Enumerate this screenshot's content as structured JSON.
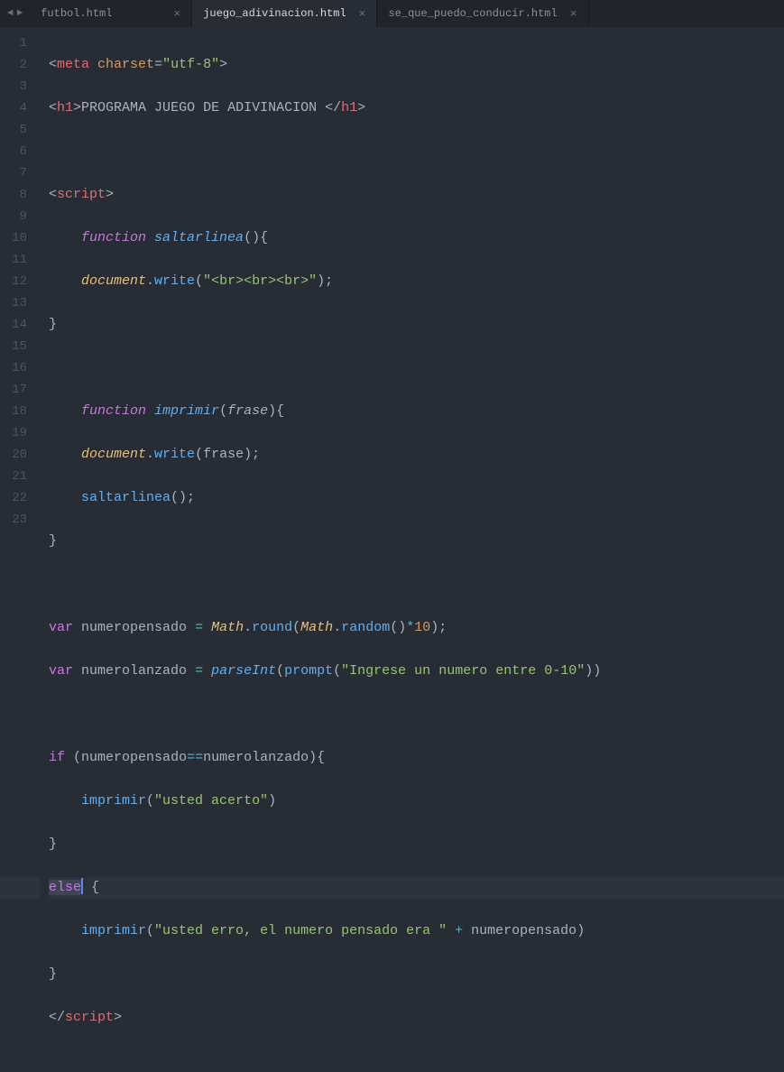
{
  "tabs": [
    {
      "label": "futbol.html",
      "active": false
    },
    {
      "label": "juego_adivinacion.html",
      "active": true
    },
    {
      "label": "se_que_puedo_conducir.html",
      "active": false
    }
  ],
  "lineNumbers": [
    "1",
    "2",
    "3",
    "4",
    "5",
    "6",
    "7",
    "8",
    "9",
    "10",
    "11",
    "12",
    "13",
    "14",
    "15",
    "16",
    "17",
    "18",
    "19",
    "20",
    "21",
    "22",
    "23"
  ],
  "tokens": {
    "meta": "meta",
    "charset": "charset",
    "utf8": "\"utf-8\"",
    "h1open": "h1",
    "h1text": "PROGRAMA JUEGO DE ADIVINACION ",
    "h1close": "h1",
    "script": "script",
    "function": "function",
    "saltarlinea": "saltarlinea",
    "document": "document",
    "write": "write",
    "brstr": "\"<br><br><br>\"",
    "imprimir": "imprimir",
    "frase": "frase",
    "var": "var",
    "numeropensado": "numeropensado",
    "Math": "Math",
    "round": "round",
    "random": "random",
    "ten": "10",
    "numerolanzado": "numerolanzado",
    "parseInt": "parseInt",
    "prompt": "prompt",
    "ingrese": "\"Ingrese un numero entre 0-10\"",
    "if": "if",
    "acerto": "\"usted acerto\"",
    "else": "else",
    "erro": "\"usted erro, el numero pensado era \"",
    "scriptclose": "script"
  }
}
